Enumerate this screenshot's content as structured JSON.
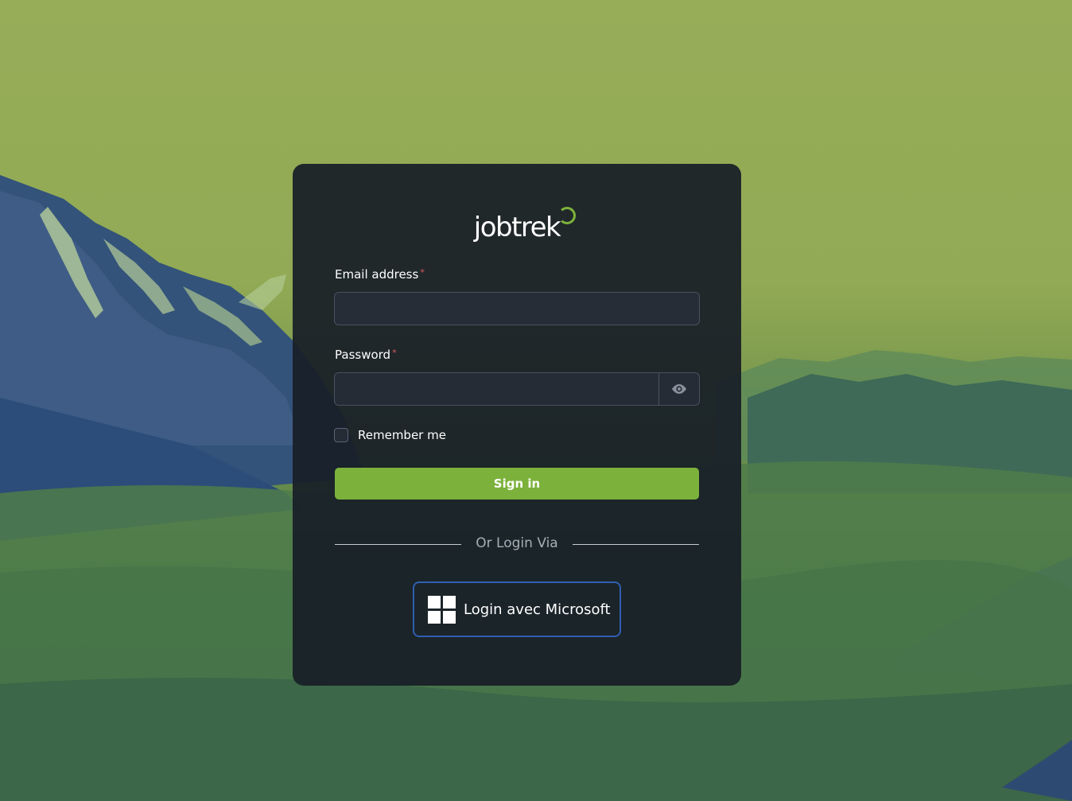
{
  "brand": {
    "logo_text": "jobtrek",
    "accent_color": "#7cb13b"
  },
  "form": {
    "email": {
      "label": "Email address",
      "required_mark": "*",
      "value": "",
      "placeholder": ""
    },
    "password": {
      "label": "Password",
      "required_mark": "*",
      "value": "",
      "placeholder": "",
      "toggle_icon": "eye-icon"
    },
    "remember_me": {
      "label": "Remember me",
      "checked": false
    },
    "submit_label": "Sign in"
  },
  "alt_login": {
    "divider_text": "Or Login Via",
    "microsoft_label": "Login avec Microsoft",
    "microsoft_icon": "windows-icon",
    "button_border_color": "#2f5fb0"
  }
}
